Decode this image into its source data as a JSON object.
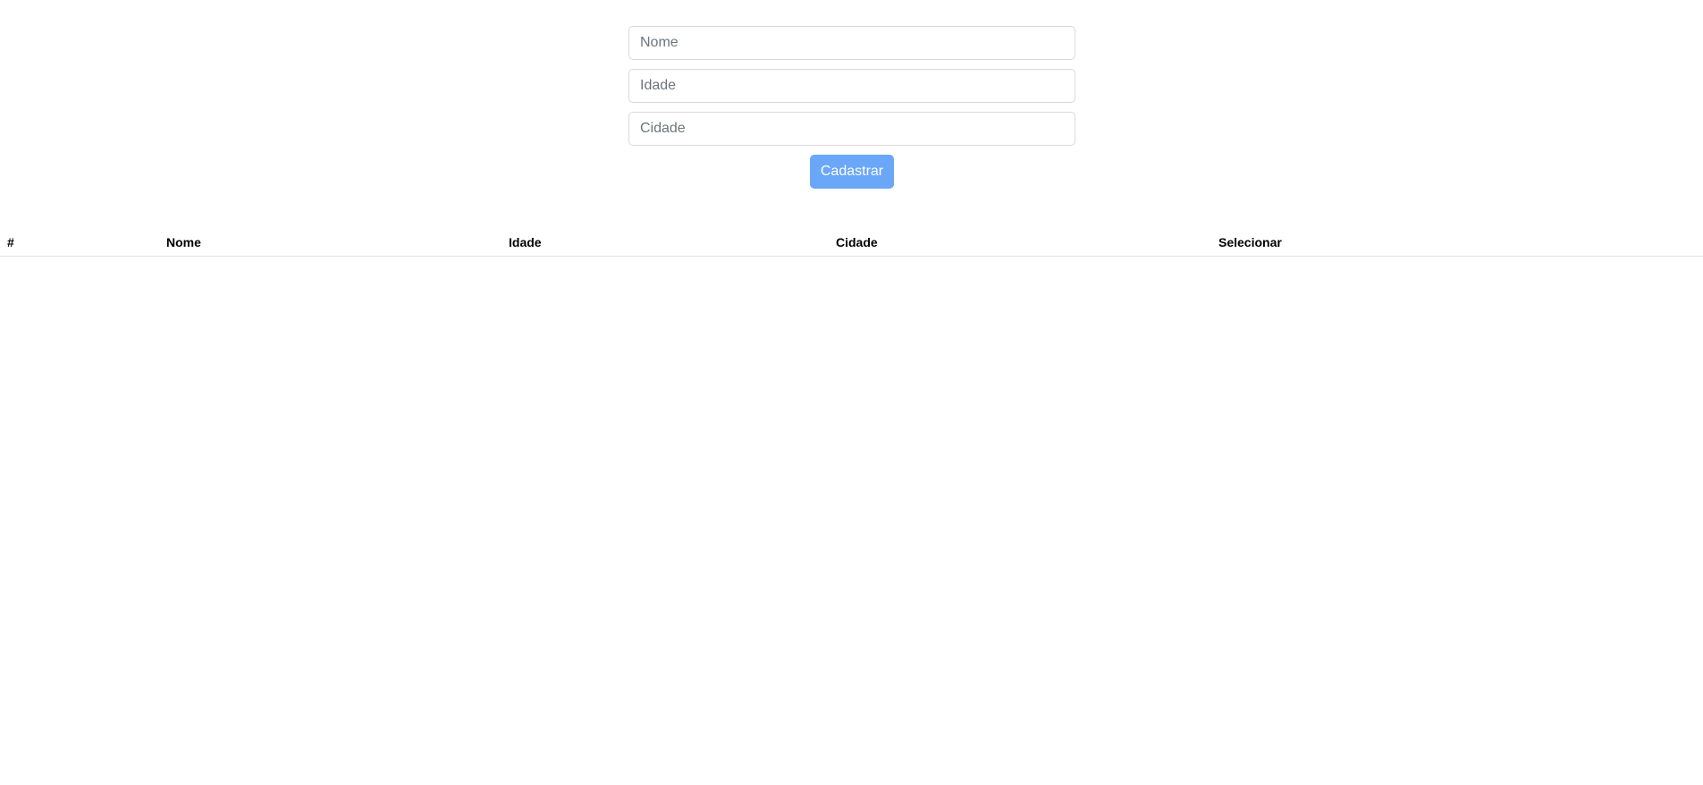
{
  "form": {
    "nome_placeholder": "Nome",
    "nome_value": "",
    "idade_placeholder": "Idade",
    "idade_value": "",
    "cidade_placeholder": "Cidade",
    "cidade_value": "",
    "submit_label": "Cadastrar",
    "submit_color": "#6aa7f8"
  },
  "table": {
    "columns": [
      "#",
      "Nome",
      "Idade",
      "Cidade",
      "Selecionar"
    ],
    "rows": []
  }
}
